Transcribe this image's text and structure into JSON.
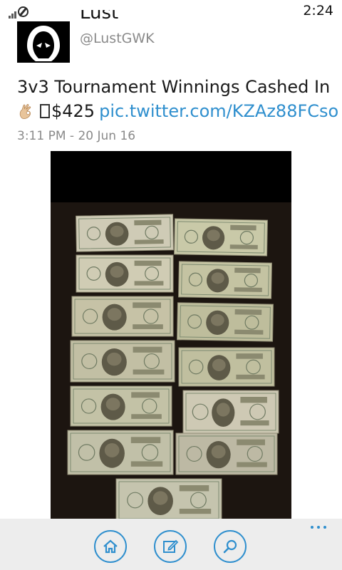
{
  "status_bar": {
    "time": "2:24"
  },
  "tweet": {
    "display_name": "Lust",
    "handle": "@LustGWK",
    "text_line1": "3v3 Tournament Winnings Cashed In",
    "amount": "$425",
    "link": "pic.twitter.com/KZAz88FCso",
    "timestamp": "3:11 PM - 20 Jun 16",
    "avatar_icon": "hooded-figure-icon",
    "emoji_icon": "ok-hand-icon",
    "missing_glyph_icon": "missing-glyph-box-icon"
  },
  "photo": {
    "content": "us-dollar-bills-on-dark-carpet"
  },
  "app_bar": {
    "buttons": [
      {
        "icon": "home-icon"
      },
      {
        "icon": "compose-icon"
      },
      {
        "icon": "search-icon"
      }
    ],
    "more_icon": "more-ellipsis-icon"
  },
  "colors": {
    "accent": "#2f8fce",
    "text": "#1a1a1a",
    "muted": "#8a8a8a",
    "appbar": "#ededed"
  }
}
